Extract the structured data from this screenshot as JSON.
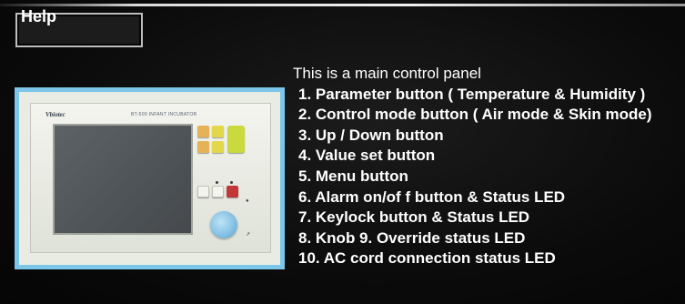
{
  "window": {
    "title": "Help"
  },
  "content": {
    "intro": "This is a main control panel",
    "items": [
      "1. Parameter button ( Temperature & Humidity )",
      "2. Control mode button ( Air mode & Skin mode)",
      "3. Up / Down button",
      "4. Value set button",
      "5. Menu button",
      "6. Alarm on/of f button & Status LED",
      "7. Keylock button & Status LED",
      "8. Knob  9. Override status LED",
      "10. AC cord connection status LED"
    ]
  },
  "image": {
    "brand": "Vbiotec",
    "model": "BT-500  INFANT  INCUBATOR"
  },
  "colors": {
    "background": "#070707",
    "text": "#ffffff",
    "image_frame": "#7cc6ea",
    "title_border": "#bdbdbd"
  }
}
